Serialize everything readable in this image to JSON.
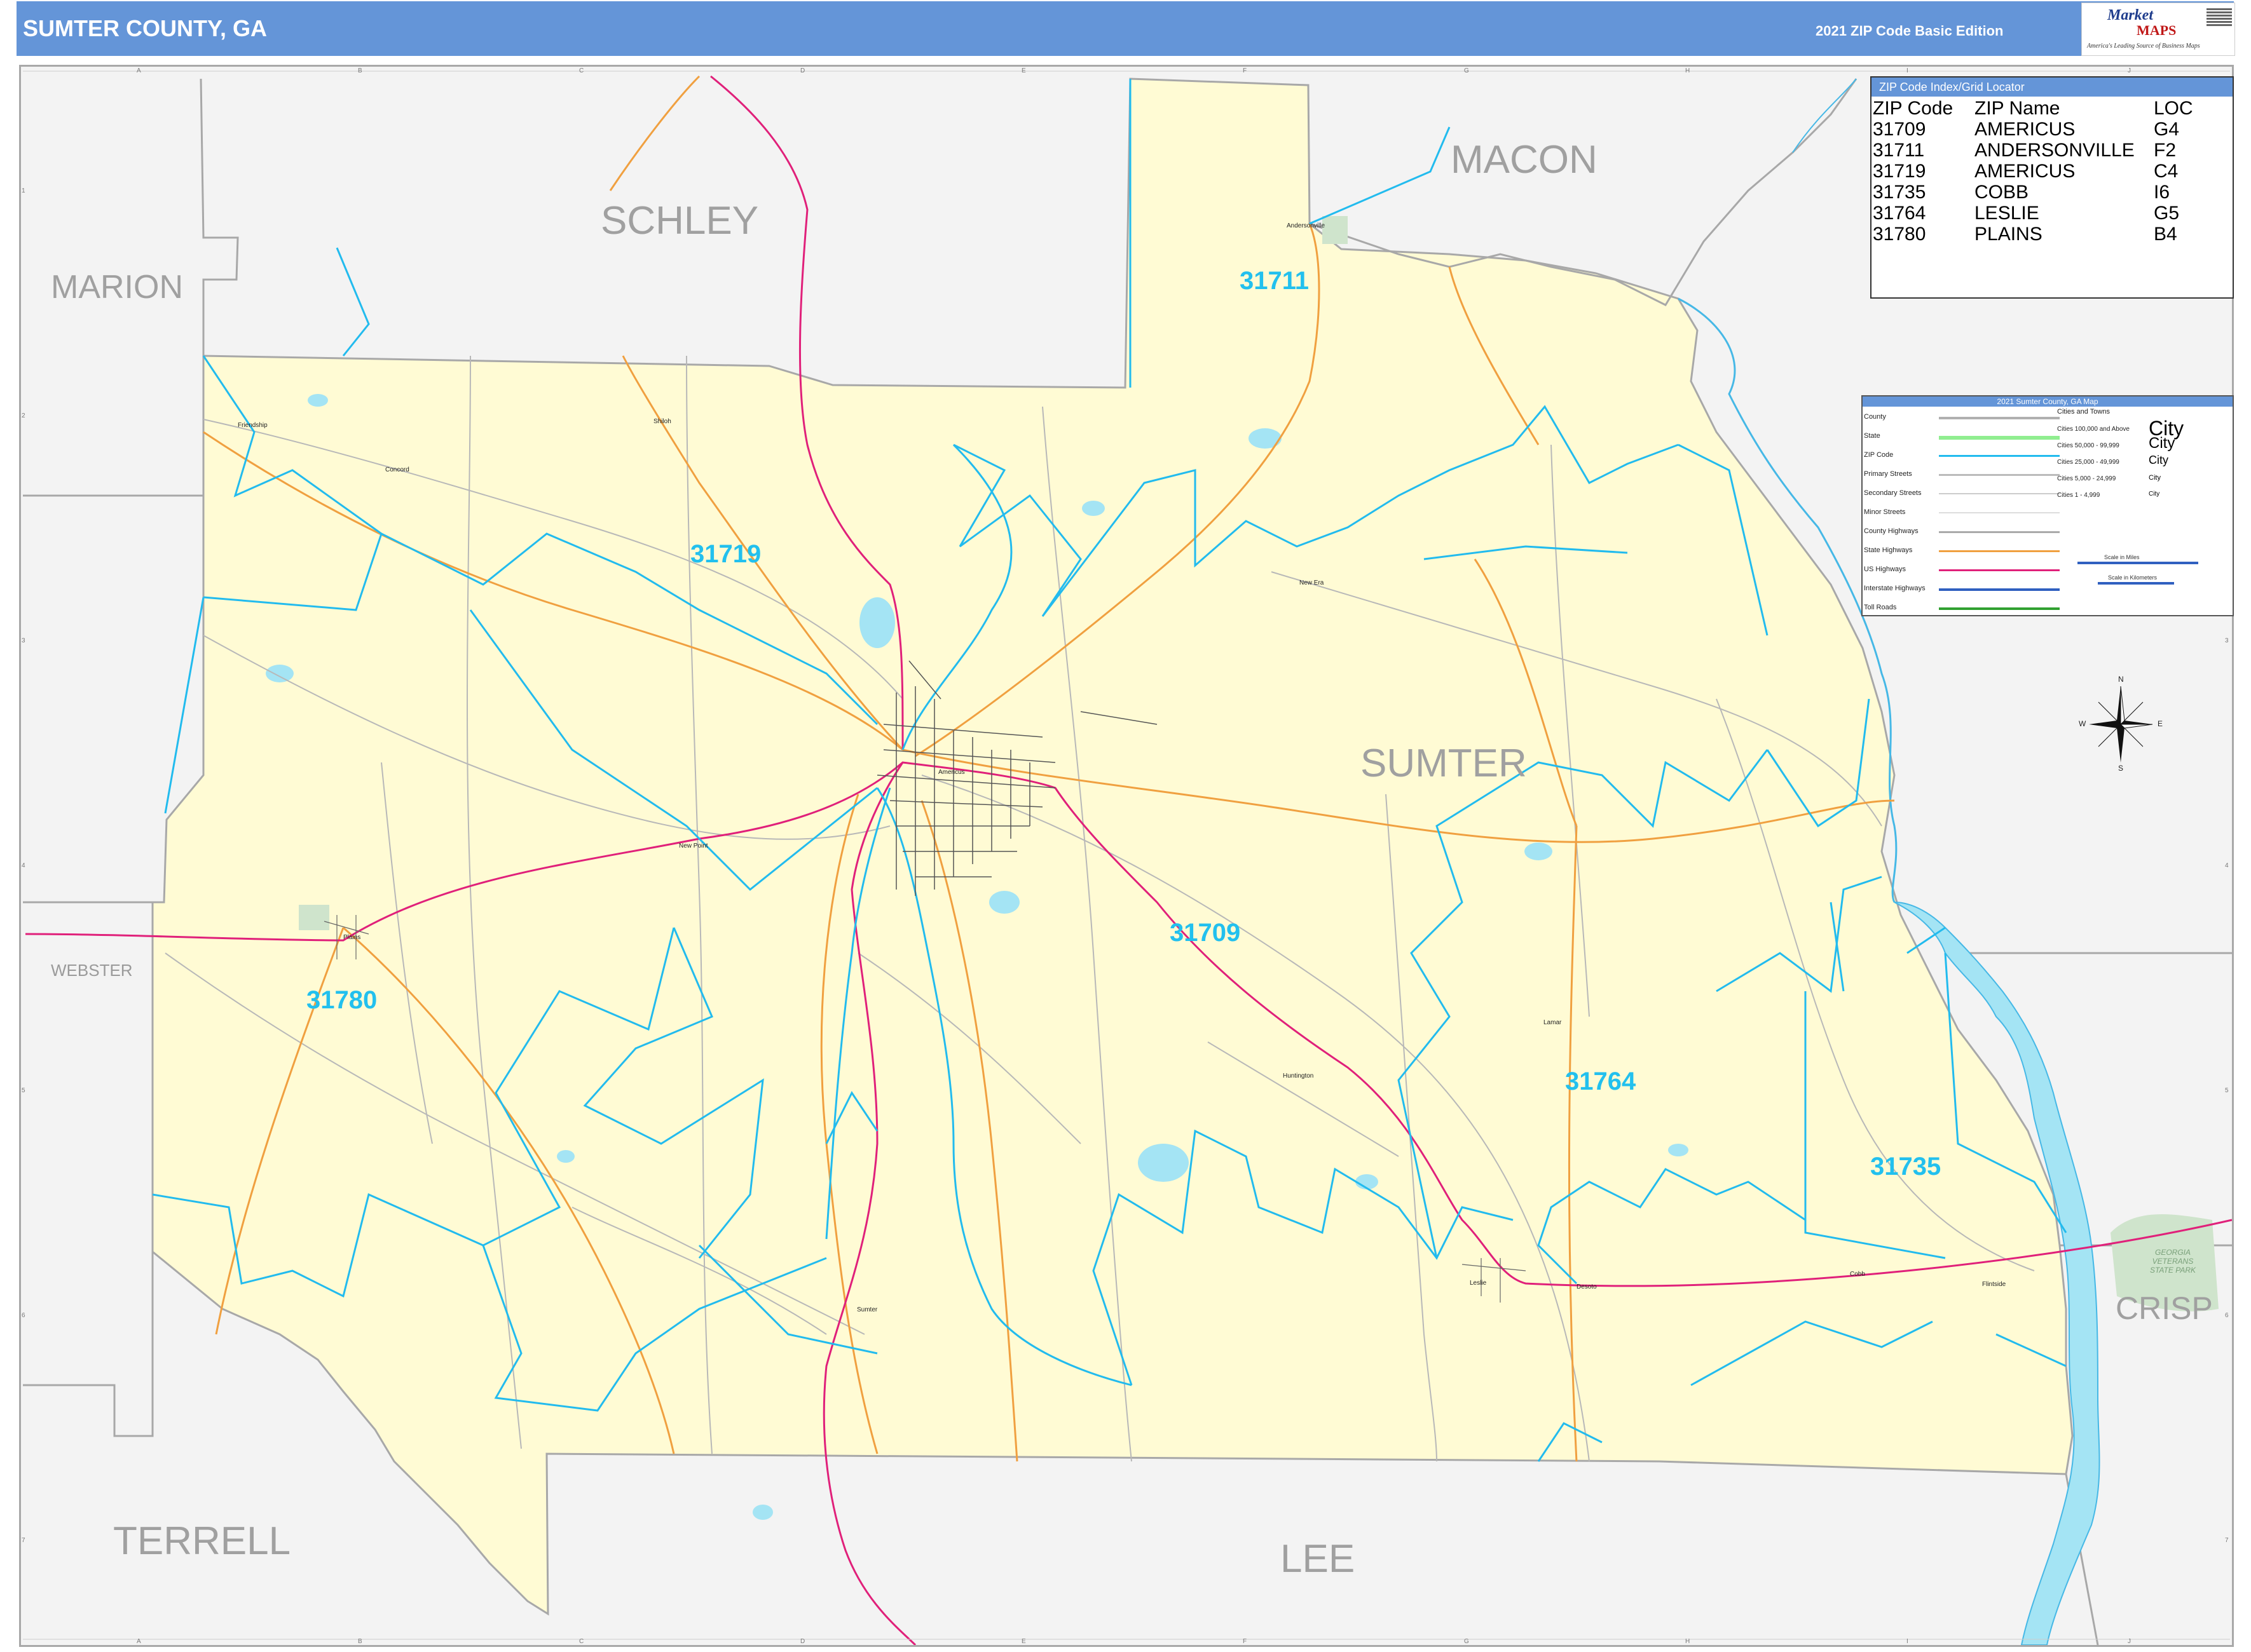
{
  "header": {
    "title": "SUMTER COUNTY, GA",
    "edition": "2021 ZIP Code Basic Edition",
    "logo_top": "Market",
    "logo_mid": "MAPS",
    "logo_tag": "America's Leading Source of Business Maps"
  },
  "colors": {
    "header_bg": "#6495d8",
    "county_fill": "#fffbd2",
    "outside_fill": "#f2f2f2",
    "zip_boundary": "#22bbee",
    "us_highway": "#e0207a",
    "state_highway": "#f0a040",
    "water": "#a4e4f4",
    "county_boundary": "#a8a8a8"
  },
  "county_labels": [
    {
      "id": "schley",
      "text": "SCHLEY"
    },
    {
      "id": "macon",
      "text": "MACON"
    },
    {
      "id": "marion",
      "text": "MARION"
    },
    {
      "id": "sumter",
      "text": "SUMTER"
    },
    {
      "id": "webster",
      "text": "WEBSTER"
    },
    {
      "id": "terrell",
      "text": "TERRELL"
    },
    {
      "id": "lee",
      "text": "LEE"
    },
    {
      "id": "crisp",
      "text": "CRISP"
    }
  ],
  "zip_labels": [
    {
      "id": "31711",
      "text": "31711"
    },
    {
      "id": "31719",
      "text": "31719"
    },
    {
      "id": "31709",
      "text": "31709"
    },
    {
      "id": "31780",
      "text": "31780"
    },
    {
      "id": "31764",
      "text": "31764"
    },
    {
      "id": "31735",
      "text": "31735"
    }
  ],
  "city_labels": [
    {
      "id": "andersonville",
      "text": "Andersonville"
    },
    {
      "id": "friendship",
      "text": "Friendship"
    },
    {
      "id": "shiloh",
      "text": "Shiloh"
    },
    {
      "id": "concord",
      "text": "Concord"
    },
    {
      "id": "americus",
      "text": "Americus"
    },
    {
      "id": "new-era",
      "text": "New Era"
    },
    {
      "id": "new-point",
      "text": "New Point"
    },
    {
      "id": "plains",
      "text": "Plains"
    },
    {
      "id": "lamar",
      "text": "Lamar"
    },
    {
      "id": "huntington",
      "text": "Huntington"
    },
    {
      "id": "sumter-city",
      "text": "Sumter"
    },
    {
      "id": "leslie",
      "text": "Leslie"
    },
    {
      "id": "desoto",
      "text": "Desoto"
    },
    {
      "id": "cobb",
      "text": "Cobb"
    },
    {
      "id": "flintside",
      "text": "Flintside"
    },
    {
      "id": "park",
      "text": "GEORGIA VETERANS STATE PARK"
    }
  ],
  "grid_letters": [
    "A",
    "B",
    "C",
    "D",
    "E",
    "F",
    "G",
    "H",
    "I",
    "J"
  ],
  "grid_numbers": [
    "1",
    "2",
    "3",
    "4",
    "5",
    "6",
    "7"
  ],
  "zip_index": {
    "title": "ZIP Code Index/Grid Locator",
    "headers": [
      "ZIP Code",
      "ZIP Name",
      "LOC"
    ],
    "rows": [
      [
        "31709",
        "AMERICUS",
        "G4"
      ],
      [
        "31711",
        "ANDERSONVILLE",
        "F2"
      ],
      [
        "31719",
        "AMERICUS",
        "C4"
      ],
      [
        "31735",
        "COBB",
        "I6"
      ],
      [
        "31764",
        "LESLIE",
        "G5"
      ],
      [
        "31780",
        "PLAINS",
        "B4"
      ]
    ]
  },
  "legend": {
    "title": "2021 Sumter County, GA Map",
    "items": [
      {
        "label": "County",
        "color": "#b0b0b0"
      },
      {
        "label": "State",
        "color": "#90ee90"
      },
      {
        "label": "ZIP Code",
        "color": "#22bbee"
      },
      {
        "label": "Primary Streets",
        "color": "#bbbbbb"
      },
      {
        "label": "Secondary Streets",
        "color": "#cccccc"
      },
      {
        "label": "Minor Streets",
        "color": "#dddddd"
      },
      {
        "label": "County Highways",
        "color": "#aaaaaa"
      },
      {
        "label": "State Highways",
        "color": "#f0a040"
      },
      {
        "label": "US Highways",
        "color": "#e0207a"
      },
      {
        "label": "Interstate Highways",
        "color": "#3060c0"
      },
      {
        "label": "Toll Roads",
        "color": "#30a030"
      }
    ],
    "cities_header": "Cities and Towns",
    "city_rows": [
      {
        "range": "Cities 100,000 and Above",
        "sample": "City"
      },
      {
        "range": "Cities 50,000 - 99,999",
        "sample": "City"
      },
      {
        "range": "Cities 25,000 - 49,999",
        "sample": "City"
      },
      {
        "range": "Cities 5,000 - 24,999",
        "sample": "City"
      },
      {
        "range": "Cities 1 - 4,999",
        "sample": "City"
      }
    ],
    "scale_miles": "Scale in Miles",
    "scale_km": "Scale in Kilometers"
  },
  "compass": {
    "n": "N",
    "s": "S",
    "e": "E",
    "w": "W"
  }
}
